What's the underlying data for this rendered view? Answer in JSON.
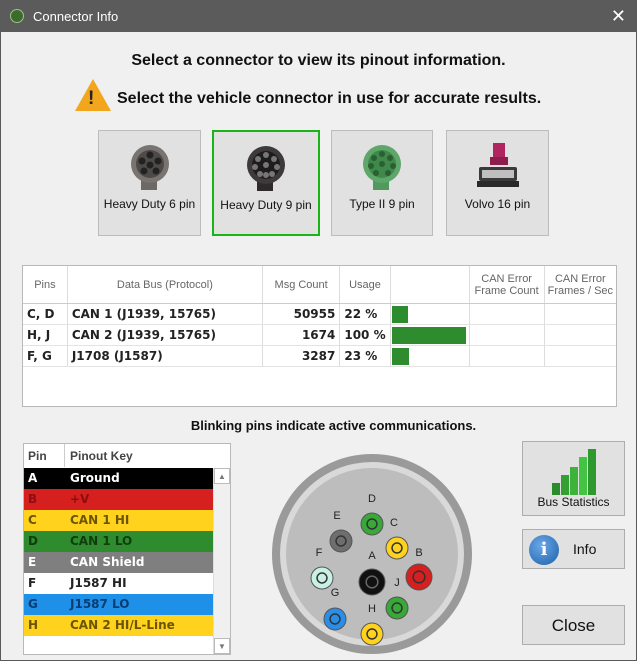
{
  "window": {
    "title": "Connector Info"
  },
  "heading": "Select a connector to view its pinout information.",
  "warning": "Select the vehicle connector in use for accurate results.",
  "connectors": [
    {
      "label": "Heavy Duty 6 pin",
      "icon": "heavy-duty-6-pin-connector",
      "selected": false,
      "color": "#7a7470"
    },
    {
      "label": "Heavy Duty 9 pin",
      "icon": "heavy-duty-9-pin-connector",
      "selected": true,
      "color": "#3e3a3a"
    },
    {
      "label": "Type II 9 pin",
      "icon": "type-ii-9-pin-connector",
      "selected": false,
      "color": "#5fa66a"
    },
    {
      "label": "Volvo 16 pin",
      "icon": "volvo-16-pin-connector",
      "selected": false,
      "color": "#b0245f"
    }
  ],
  "bus_table": {
    "columns": [
      "Pins",
      "Data Bus (Protocol)",
      "Msg Count",
      "Usage",
      "",
      "CAN Error Frame Count",
      "CAN Error Frames / Sec"
    ],
    "rows": [
      {
        "pins": "C, D",
        "bus": "CAN 1 (J1939, 15765)",
        "msg_count": "50955",
        "usage": "22 %",
        "usage_fraction": 0.22
      },
      {
        "pins": "H, J",
        "bus": "CAN 2 (J1939, 15765)",
        "msg_count": "1674",
        "usage": "100 %",
        "usage_fraction": 1.0
      },
      {
        "pins": "F, G",
        "bus": "J1708 (J1587)",
        "msg_count": "3287",
        "usage": "23 %",
        "usage_fraction": 0.23
      }
    ]
  },
  "blink_note": "Blinking pins indicate active communications.",
  "pinout": {
    "header_pin": "Pin",
    "header_key": "Pinout Key",
    "rows": [
      {
        "pin": "A",
        "key": "Ground",
        "bg": "#000000",
        "fg": "#ffffff"
      },
      {
        "pin": "B",
        "key": "+V",
        "bg": "#d61f1f",
        "fg": "#8b0f0f"
      },
      {
        "pin": "C",
        "key": "CAN 1 HI",
        "bg": "#ffd21e",
        "fg": "#6b5500"
      },
      {
        "pin": "D",
        "key": "CAN 1 LO",
        "bg": "#2e8b2e",
        "fg": "#0f3d0f"
      },
      {
        "pin": "E",
        "key": "CAN Shield",
        "bg": "#7f7f7f",
        "fg": "#ffffff"
      },
      {
        "pin": "F",
        "key": "J1587 HI",
        "bg": "#ffffff",
        "fg": "#222222"
      },
      {
        "pin": "G",
        "key": "J1587 LO",
        "bg": "#1e90e8",
        "fg": "#0a3c72"
      },
      {
        "pin": "H",
        "key": "CAN 2 HI/L-Line",
        "bg": "#ffd21e",
        "fg": "#6b5500"
      }
    ]
  },
  "diagram": {
    "pins": [
      {
        "label": "A",
        "color": "#111111"
      },
      {
        "label": "B",
        "color": "#d61f1f"
      },
      {
        "label": "C",
        "color": "#ffd21e"
      },
      {
        "label": "D",
        "color": "#38a838"
      },
      {
        "label": "E",
        "color": "#6e6e6e"
      },
      {
        "label": "F",
        "color": "#c8f0e4"
      },
      {
        "label": "G",
        "color": "#2a8ee8"
      },
      {
        "label": "H",
        "color": "#ffd21e"
      },
      {
        "label": "J",
        "color": "#38a838"
      }
    ]
  },
  "buttons": {
    "stats": "Bus Statistics",
    "info": "Info",
    "info_icon_glyph": "i",
    "close": "Close"
  }
}
